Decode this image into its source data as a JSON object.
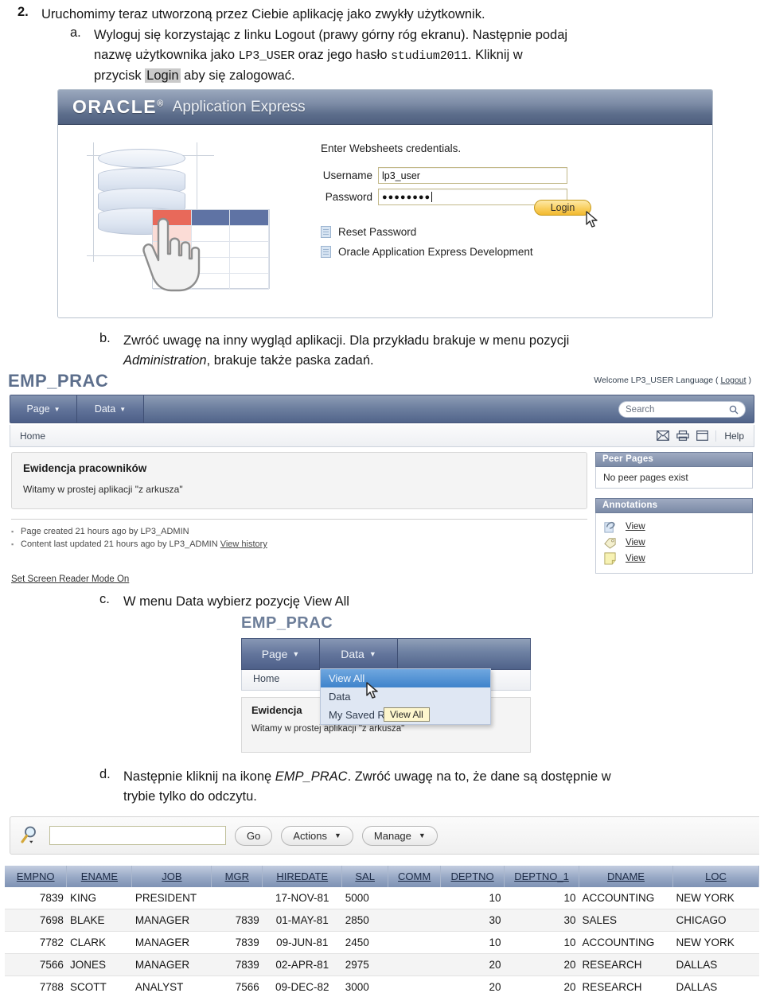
{
  "document": {
    "item_number": "2.",
    "item_text": "Uruchomimy teraz utworzoną przez Ciebie aplikację jako zwykły użytkownik.",
    "sub_a": {
      "letter": "a.",
      "line1_part1": "Wyloguj się korzystając z linku Logout (prawy górny róg ekranu). Następnie podaj",
      "line2_part1": "nazwę użytkownika jako ",
      "line2_mono1": "LP3_USER",
      "line2_part2": " oraz jego hasło ",
      "line2_mono2": "studium2011",
      "line2_part3": ". Kliknij w",
      "line3_part1": "przycisk ",
      "line3_hl": "Login",
      "line3_part2": " aby się zalogować."
    },
    "sub_b": {
      "letter": "b.",
      "line1": "Zwróć uwagę na inny wygląd aplikacji. Dla przykładu brakuje w menu pozycji",
      "line2_italic": "Administration",
      "line2_rest": ", brakuje także paska zadań."
    },
    "sub_c": {
      "letter": "c.",
      "line1": "W menu Data wybierz pozycję View All"
    },
    "sub_d": {
      "letter": "d.",
      "line1_part1": "Następnie kliknij na ikonę ",
      "line1_italic": "EMP_PRAC",
      "line1_part2": ".  Zwróć uwagę na to, że dane są dostępnie w",
      "line2": "trybie tylko do odczytu."
    }
  },
  "apex_login": {
    "brand": "ORACLE",
    "brand_sup": "®",
    "product": "Application Express",
    "hint": "Enter Websheets credentials.",
    "username_label": "Username",
    "username_value": "lp3_user",
    "password_label": "Password",
    "password_value": "●●●●●●●●",
    "login_button": "Login",
    "links": [
      {
        "icon": "document-icon",
        "label": "Reset Password"
      },
      {
        "icon": "document-icon",
        "label": "Oracle Application Express Development"
      }
    ],
    "colors": {
      "header_top": "#9aa8bd",
      "header_bottom": "#4e5f7e",
      "button": "#f2b92f"
    }
  },
  "emp_websheet": {
    "app_title": "EMP_PRAC",
    "welcome": "Welcome LP3_USER  Language  ( ",
    "welcome_logout": "Logout",
    "welcome_close": " )",
    "tabs": [
      {
        "label": "Page",
        "caret": "▼"
      },
      {
        "label": "Data",
        "caret": "▼"
      }
    ],
    "search_placeholder": "Search",
    "breadcrumb": "Home",
    "breadcrumb_icons": [
      "mail-icon",
      "print-icon",
      "window-icon"
    ],
    "help_label": "Help",
    "content": {
      "heading": "Ewidencja pracowników",
      "body": "Witamy w prostej aplikacji \"z arkusza\""
    },
    "meta": [
      "Page created 21 hours ago by LP3_ADMIN",
      "Content last updated 21 hours ago by LP3_ADMIN "
    ],
    "meta_link": "View history",
    "screen_reader": "Set Screen Reader Mode On",
    "peer_pages": {
      "title": "Peer Pages",
      "empty": "No peer pages exist"
    },
    "annotations": {
      "title": "Annotations",
      "rows": [
        {
          "icon": "attachment-icon",
          "label": "View"
        },
        {
          "icon": "tag-icon",
          "label": "View"
        },
        {
          "icon": "note-icon",
          "label": "View"
        }
      ]
    }
  },
  "data_menu": {
    "app_title": "EMP_PRAC",
    "tabs": [
      {
        "label": "Page",
        "caret": "▼"
      },
      {
        "label": "Data",
        "caret": "▼"
      }
    ],
    "breadcrumb": "Home",
    "menu_items": [
      {
        "label": "View All",
        "selected": true
      },
      {
        "label": "Data",
        "selected": false
      },
      {
        "label": "My Saved Reports",
        "selected": false
      }
    ],
    "tooltip": "View All",
    "content": {
      "heading": "Ewidencja",
      "body": "Witamy w prostej aplikacji \"z arkusza\""
    }
  },
  "report": {
    "search_value": "",
    "go_button": "Go",
    "actions_button": "Actions",
    "manage_button": "Manage",
    "caret": "▼",
    "columns": [
      "EMPNO",
      "ENAME",
      "JOB",
      "MGR",
      "HIREDATE",
      "SAL",
      "COMM",
      "DEPTNO",
      "DEPTNO_1",
      "DNAME",
      "LOC"
    ],
    "rows": [
      [
        "7839",
        "KING",
        "PRESIDENT",
        "",
        "17-NOV-81",
        "5000",
        "",
        "10",
        "10",
        "ACCOUNTING",
        "NEW YORK"
      ],
      [
        "7698",
        "BLAKE",
        "MANAGER",
        "7839",
        "01-MAY-81",
        "2850",
        "",
        "30",
        "30",
        "SALES",
        "CHICAGO"
      ],
      [
        "7782",
        "CLARK",
        "MANAGER",
        "7839",
        "09-JUN-81",
        "2450",
        "",
        "10",
        "10",
        "ACCOUNTING",
        "NEW YORK"
      ],
      [
        "7566",
        "JONES",
        "MANAGER",
        "7839",
        "02-APR-81",
        "2975",
        "",
        "20",
        "20",
        "RESEARCH",
        "DALLAS"
      ],
      [
        "7788",
        "SCOTT",
        "ANALYST",
        "7566",
        "09-DEC-82",
        "3000",
        "",
        "20",
        "20",
        "RESEARCH",
        "DALLAS"
      ]
    ]
  }
}
